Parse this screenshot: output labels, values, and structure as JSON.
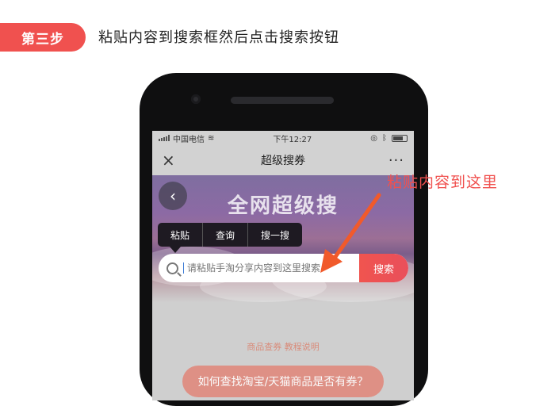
{
  "step": {
    "badge": "第三步",
    "title": "粘贴内容到搜索框然后点击搜索按钮"
  },
  "statusbar": {
    "carrier": "中国电信",
    "time": "下午12:27"
  },
  "navbar": {
    "title": "超级搜券",
    "close_icon": "×",
    "more_icon": "···"
  },
  "banner": {
    "title": "全网超级搜",
    "back_icon": "‹"
  },
  "context_menu": {
    "items": [
      "粘贴",
      "查询",
      "搜一搜"
    ]
  },
  "search": {
    "placeholder": "请粘贴手淘分享内容到这里搜索",
    "button_label": "搜索"
  },
  "links": {
    "text": "商品查券 教程说明"
  },
  "pill": {
    "text": "如何查找淘宝/天猫商品是否有券？"
  },
  "annotation": {
    "text": "粘贴内容到这里"
  },
  "colors": {
    "accent": "#f0514f",
    "arrow": "#f15a2b",
    "search_button": "#ef5350"
  }
}
